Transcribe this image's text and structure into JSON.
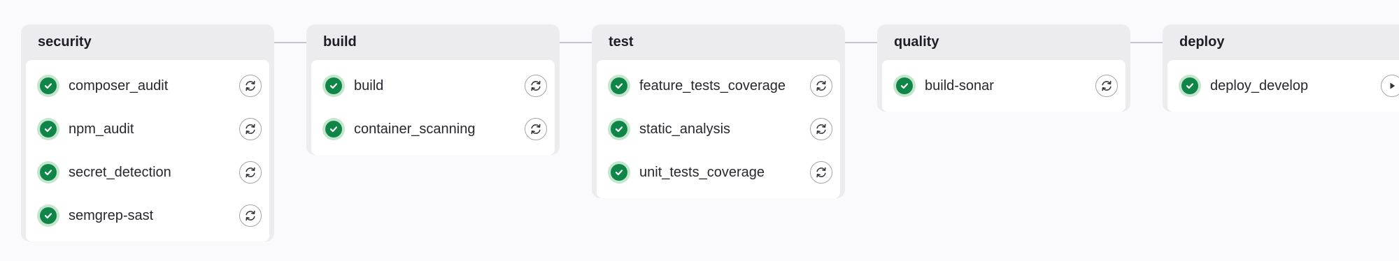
{
  "stages": [
    {
      "id": "security",
      "title": "security",
      "jobs": [
        {
          "name": "composer_audit",
          "status": "success",
          "action": "retry-icon"
        },
        {
          "name": "npm_audit",
          "status": "success",
          "action": "retry-icon"
        },
        {
          "name": "secret_detection",
          "status": "success",
          "action": "retry-icon"
        },
        {
          "name": "semgrep-sast",
          "status": "success",
          "action": "retry-icon"
        }
      ]
    },
    {
      "id": "build",
      "title": "build",
      "jobs": [
        {
          "name": "build",
          "status": "success",
          "action": "retry-icon"
        },
        {
          "name": "container_scanning",
          "status": "success",
          "action": "retry-icon"
        }
      ]
    },
    {
      "id": "test",
      "title": "test",
      "jobs": [
        {
          "name": "feature_tests_coverage",
          "status": "success",
          "action": "retry-icon"
        },
        {
          "name": "static_analysis",
          "status": "success",
          "action": "retry-icon"
        },
        {
          "name": "unit_tests_coverage",
          "status": "success",
          "action": "retry-icon"
        }
      ]
    },
    {
      "id": "quality",
      "title": "quality",
      "jobs": [
        {
          "name": "build-sonar",
          "status": "success",
          "action": "retry-icon"
        }
      ]
    },
    {
      "id": "deploy",
      "title": "deploy",
      "jobs": [
        {
          "name": "deploy_develop",
          "status": "success",
          "action": "play-icon"
        }
      ]
    }
  ],
  "colors": {
    "success": "#108548",
    "success_ring": "#c3e6cd",
    "stage_bg": "#ececef",
    "connector": "#c4c4cc"
  }
}
